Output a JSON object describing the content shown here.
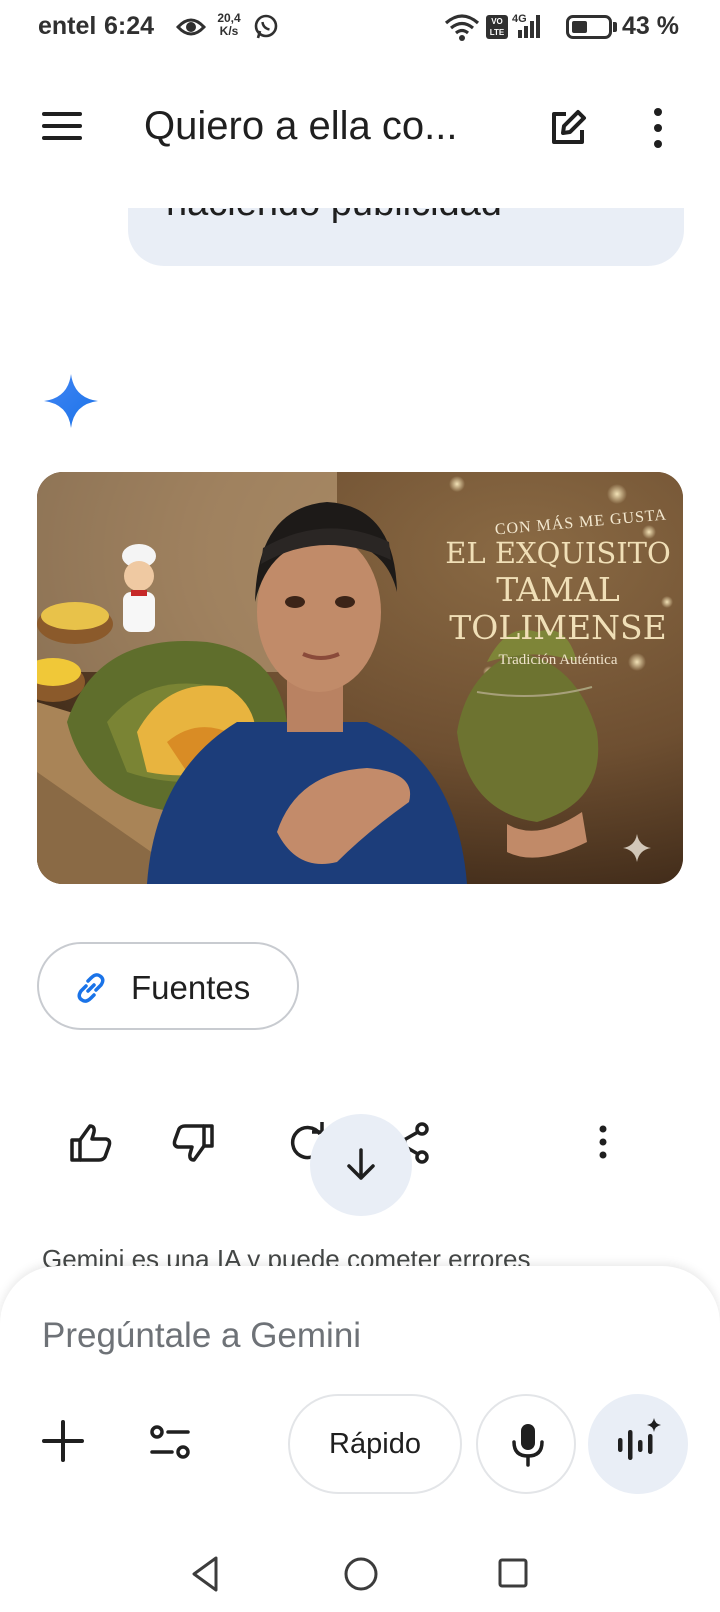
{
  "status_bar": {
    "carrier": "entel",
    "time": "6:24",
    "net_speed_value": "20,4",
    "net_speed_unit": "K/s",
    "volte_line1": "VO",
    "volte_line2": "LTE",
    "network_type": "4G",
    "battery_percent": "43 %",
    "battery_level": 0.43
  },
  "app_bar": {
    "title": "Quiero a ella co...",
    "icons": [
      "menu-icon",
      "edit-icon",
      "more-vert-icon"
    ]
  },
  "chat": {
    "user_message_visible": "haciendo publicidad",
    "generated_image": {
      "tag": "CON MÁS ME GUSTA",
      "line1": "EL EXQUISITO",
      "line2": "TAMAL",
      "line3": "TOLIMENSE",
      "subtitle": "Tradición Auténtica"
    },
    "sources_label": "Fuentes",
    "actions": [
      "thumb-up-icon",
      "thumb-down-icon",
      "regenerate-icon",
      "share-icon",
      "more-vert-icon"
    ],
    "disclaimer": "Gemini es una IA y puede cometer errores"
  },
  "input": {
    "placeholder": "Pregúntale a Gemini",
    "model_label": "Rápido",
    "icons": [
      "plus-icon",
      "tools-icon",
      "mic-icon",
      "live-icon"
    ]
  },
  "colors": {
    "accent_blue": "#1a73e8",
    "bubble_bg": "#e9eef6",
    "text": "#1f1f1f"
  }
}
